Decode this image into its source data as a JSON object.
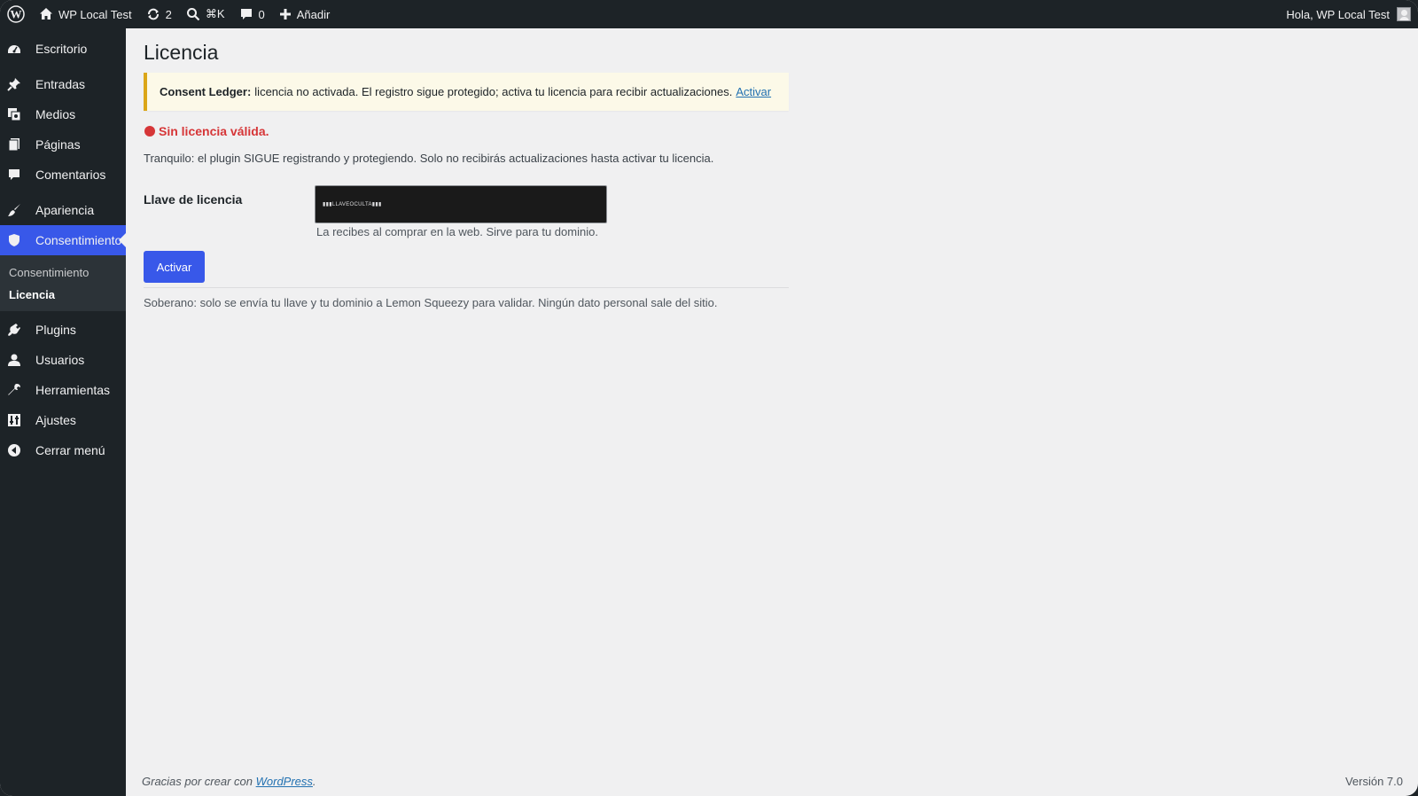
{
  "adminbar": {
    "site_name": "WP Local Test",
    "updates_count": "2",
    "search_shortcut": "⌘K",
    "comments_count": "0",
    "new_label": "Añadir",
    "greeting": "Hola, WP Local Test"
  },
  "sidebar": {
    "items": [
      {
        "label": "Escritorio",
        "icon": "dashboard-icon"
      },
      {
        "label": "Entradas",
        "icon": "pin-icon"
      },
      {
        "label": "Medios",
        "icon": "media-icon"
      },
      {
        "label": "Páginas",
        "icon": "pages-icon"
      },
      {
        "label": "Comentarios",
        "icon": "comments-icon"
      },
      {
        "label": "Apariencia",
        "icon": "appearance-icon"
      },
      {
        "label": "Consentimiento",
        "icon": "shield-icon"
      },
      {
        "label": "Plugins",
        "icon": "plugins-icon"
      },
      {
        "label": "Usuarios",
        "icon": "users-icon"
      },
      {
        "label": "Herramientas",
        "icon": "tools-icon"
      },
      {
        "label": "Ajustes",
        "icon": "settings-icon"
      },
      {
        "label": "Cerrar menú",
        "icon": "collapse-icon"
      }
    ],
    "submenu": [
      {
        "label": "Consentimiento"
      },
      {
        "label": "Licencia"
      }
    ]
  },
  "page": {
    "title": "Licencia",
    "notice": {
      "plugin": "Consent Ledger:",
      "text": "licencia no activada. El registro sigue protegido; activa tu licencia para recibir actualizaciones.",
      "link": "Activar"
    },
    "status": "Sin licencia válida.",
    "description": "Tranquilo: el plugin SIGUE registrando y protegiendo. Solo no recibirás actualizaciones hasta activar tu licencia.",
    "field_label": "Llave de licencia",
    "key_value": "▮▮▮LLAVEOCULTA▮▮▮",
    "help": "La recibes al comprar en la web. Sirve para tu dominio.",
    "button": "Activar",
    "sovereign": "Soberano: solo se envía tu llave y tu dominio a Lemon Squeezy para validar. Ningún dato personal sale del sitio."
  },
  "footer": {
    "thanks_prefix": "Gracias por crear con",
    "link": "WordPress",
    "thanks_suffix": ".",
    "version": "Versión 7.0"
  },
  "colors": {
    "accent": "#3858e9",
    "error": "#d63638",
    "warning_border": "#dba617"
  }
}
